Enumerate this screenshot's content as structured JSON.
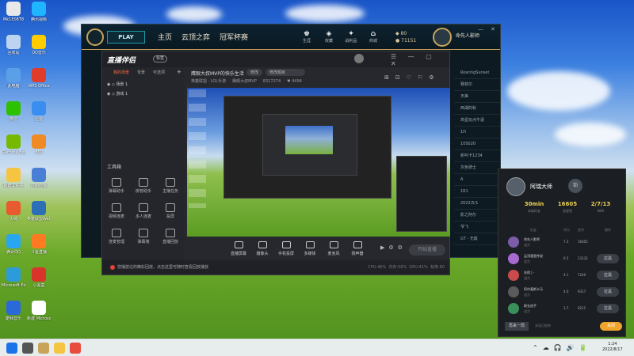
{
  "desktop": {
    "icons": [
      {
        "label": "Mk1E08T8",
        "color": "#e8e8e8"
      },
      {
        "label": "腾讯视频",
        "color": "#1fb6ff"
      },
      {
        "label": "回收站",
        "color": "#bcd4f0"
      },
      {
        "label": "QQ音乐",
        "color": "#ffcc00"
      },
      {
        "label": "此电脑",
        "color": "#5aa0e8"
      },
      {
        "label": "WPS Office",
        "color": "#e03c2c"
      },
      {
        "label": "微信",
        "color": "#2dc100"
      },
      {
        "label": "迅雷",
        "color": "#3a8ef0"
      },
      {
        "label": "GeForce Experience",
        "color": "#76b900"
      },
      {
        "label": "360",
        "color": "#f08a24"
      },
      {
        "label": "新建文件夹",
        "color": "#f5c542"
      },
      {
        "label": "控制面板",
        "color": "#4a7fd6"
      },
      {
        "label": "火绒",
        "color": "#e85a30"
      },
      {
        "label": "英雄联盟WeGame版",
        "color": "#2d6fb7"
      },
      {
        "label": "腾讯QQ",
        "color": "#2aa6f0"
      },
      {
        "label": "斗鱼直播",
        "color": "#ff7a20"
      },
      {
        "label": "Microsoft Edge",
        "color": "#2c9bd9"
      },
      {
        "label": "小黑盒",
        "color": "#d9342b"
      },
      {
        "label": "酷我音乐",
        "color": "#2b68d8"
      },
      {
        "label": "新建 Microsoft Word 文档",
        "color": "#ffffff"
      }
    ]
  },
  "lol": {
    "play_label": "PLAY",
    "tabs": [
      "主页",
      "云顶之弈",
      "冠军杯赛"
    ],
    "nav_icons": [
      {
        "label": "生涯",
        "glyph": "♚"
      },
      {
        "label": "收藏",
        "glyph": "◈"
      },
      {
        "label": "战利品",
        "glyph": "✦"
      },
      {
        "label": "商城",
        "glyph": "⌂"
      }
    ],
    "rp_value": "80",
    "be_value": "71151",
    "summoner_name": "命先人影师",
    "right_list": [
      "RoaringSunset",
      "赛菲尔",
      "天美",
      "西湖的秋",
      "高星玩点牛逼",
      "1H",
      "10S020",
      "新叫卡1234",
      "灰色骑士",
      "A",
      "1R1",
      "2022/5/1",
      "影之阿尔",
      "爷飞",
      "GT - 无敌"
    ]
  },
  "zb": {
    "brand": "直播伴侣",
    "badge": "标签",
    "room_title": "鹰眼大叔MVP的快乐生活",
    "tag1": "修改",
    "tag2": "修改题目",
    "meta": [
      "英雄联盟 · LOL手游",
      "鹰眼大叔MVP",
      "8317274",
      "♥ 4494"
    ],
    "side_tabs": [
      "我的场景",
      "背景",
      "可选项"
    ],
    "scenes": [
      "◉ ◇ 场景 1",
      "◉ ◇ 游戏 1"
    ],
    "tool_header": "工具箱",
    "tools": [
      "弹幕助手",
      "房管助手",
      "主播任务",
      "视频连麦",
      "多人连麦",
      "投屏",
      "连麦管理",
      "弹幕墙",
      "直播回放"
    ],
    "bottom_buttons": [
      "直播屏幕",
      "摄像头",
      "手机投屏",
      "多媒体",
      "麦克风",
      "扬声器"
    ],
    "live_button": "开始直播",
    "tip": "您播放过的精彩回放，点击这里可随时查看回放播放",
    "stats": [
      "CPU:46%",
      "内存:56%",
      "GPU:41%",
      "帧率:60"
    ]
  },
  "rank_panel": {
    "player_name": "阿瑞大师",
    "rank_badge": "铂",
    "stats": [
      {
        "value": "30min",
        "label": "本局时长"
      },
      {
        "value": "16605",
        "label": "总经验"
      },
      {
        "value": "2/7/13",
        "label": "KDA"
      }
    ],
    "headers": [
      "队友",
      "评分",
      "经济",
      "操作"
    ],
    "players": [
      {
        "name": "命先人影师",
        "title": "战力",
        "score": "7.3",
        "gold": "16605",
        "button": "",
        "color": "#7a5ca8"
      },
      {
        "name": "云顶我是传说",
        "title": "战力",
        "score": "6.5",
        "gold": "13132",
        "button": "拉黑",
        "color": "#a86ad1"
      },
      {
        "name": "灰烬 | -",
        "title": "战力",
        "score": "4.1",
        "gold": "7240",
        "button": "拉黑",
        "color": "#c94b4b"
      },
      {
        "name": "阿尔泰斯卡马",
        "title": "战力",
        "score": "4.0",
        "gold": "9317",
        "button": "拉黑",
        "color": "#5a5a5a"
      },
      {
        "name": "职业选手",
        "title": "战力",
        "score": "3.7",
        "gold": "9211",
        "button": "拉黑",
        "color": "#3a8f5a"
      }
    ],
    "footer_left": "再来一局",
    "footer_mid": "本局已结束",
    "footer_right": "关闭"
  },
  "taskbar": {
    "apps": [
      {
        "name": "windows-start",
        "color": "#1a73e8"
      },
      {
        "name": "search",
        "color": "#555555"
      },
      {
        "name": "league-client",
        "color": "#c8a45a"
      },
      {
        "name": "file-explorer",
        "color": "#f5c542"
      },
      {
        "name": "live-companion",
        "color": "#e74c3c"
      }
    ],
    "tray": [
      "⌃",
      "☁",
      "🎧",
      "🔊",
      "🔋"
    ],
    "time": "1:24",
    "date": "2022/8/17"
  }
}
